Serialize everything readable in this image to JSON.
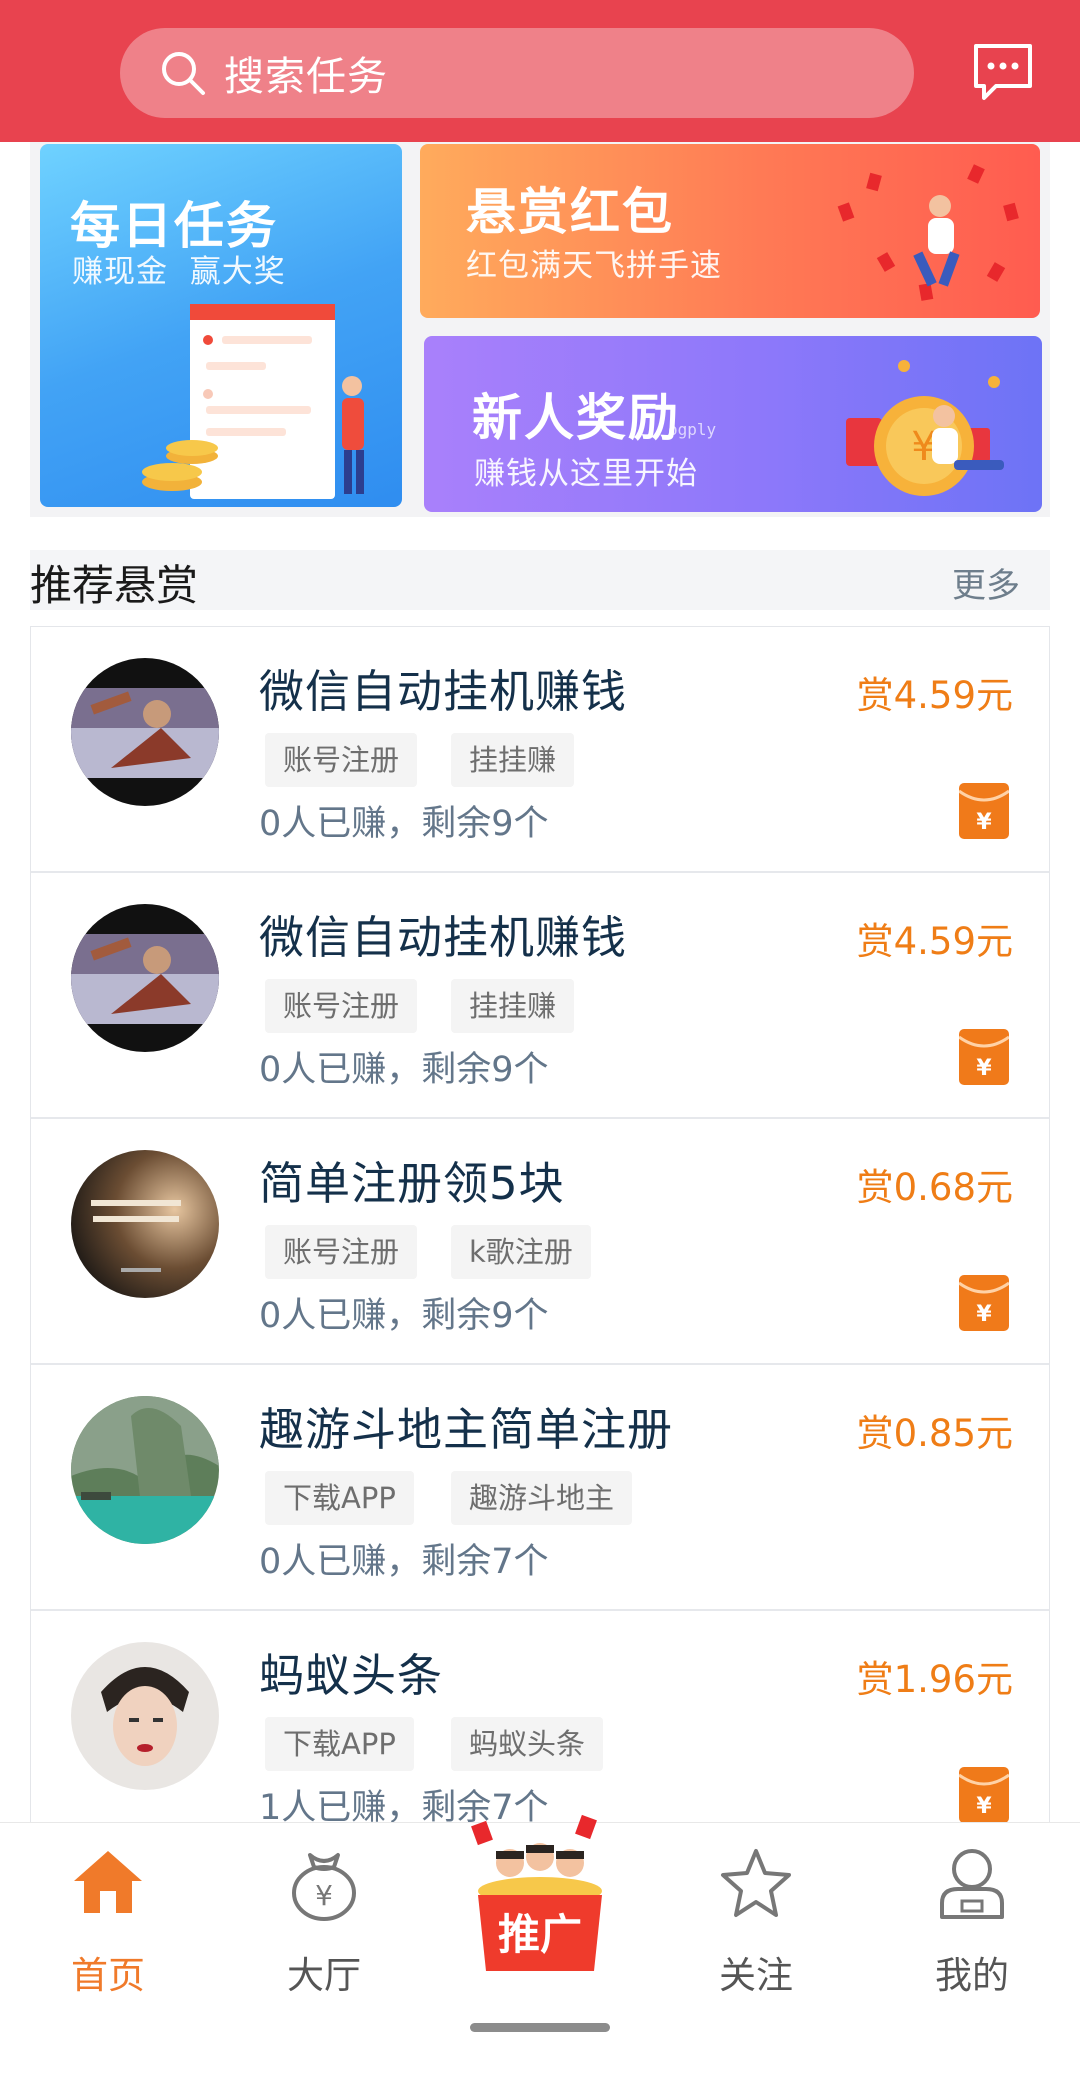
{
  "header": {
    "search_placeholder": "搜索任务",
    "search_icon": "search-icon",
    "message_icon": "message-icon",
    "bg_color": "#e8434f"
  },
  "banners": {
    "daily": {
      "title": "每日任务",
      "subtitle": "赚现金  赢大奖"
    },
    "reward": {
      "title": "悬赏红包",
      "subtitle": "红包满天飞拼手速"
    },
    "new_user": {
      "title": "新人奖励",
      "subtitle": "赚钱从这里开始",
      "watermark": "ogply"
    }
  },
  "section": {
    "title": "推荐悬赏",
    "more": "更多"
  },
  "tasks": [
    {
      "title": "微信自动挂机赚钱",
      "reward": "赏4.59元",
      "tags": [
        "账号注册",
        "挂挂赚"
      ],
      "stats": "0人已赚，剩余9个",
      "has_envelope": true
    },
    {
      "title": "微信自动挂机赚钱",
      "reward": "赏4.59元",
      "tags": [
        "账号注册",
        "挂挂赚"
      ],
      "stats": "0人已赚，剩余9个",
      "has_envelope": true
    },
    {
      "title": "简单注册领5块",
      "reward": "赏0.68元",
      "tags": [
        "账号注册",
        "k歌注册"
      ],
      "stats": "0人已赚，剩余9个",
      "has_envelope": true
    },
    {
      "title": "趣游斗地主简单注册",
      "reward": "赏0.85元",
      "tags": [
        "下载APP",
        "趣游斗地主"
      ],
      "stats": "0人已赚，剩余7个",
      "has_envelope": false
    },
    {
      "title": "蚂蚁头条",
      "reward": "赏1.96元",
      "tags": [
        "下载APP",
        "蚂蚁头条"
      ],
      "stats": "1人已赚，剩余7个",
      "has_envelope": true
    }
  ],
  "tabbar": {
    "items": [
      {
        "label": "首页",
        "icon": "home-icon",
        "active": true
      },
      {
        "label": "大厅",
        "icon": "money-bag-icon",
        "active": false
      },
      {
        "label": "推广",
        "icon": "promotion-icon",
        "active": false
      },
      {
        "label": "关注",
        "icon": "star-icon",
        "active": false
      },
      {
        "label": "我的",
        "icon": "user-icon",
        "active": false
      }
    ],
    "active_color": "#f07a2a"
  },
  "colors": {
    "accent": "#ef7d16",
    "title": "#14304a"
  }
}
